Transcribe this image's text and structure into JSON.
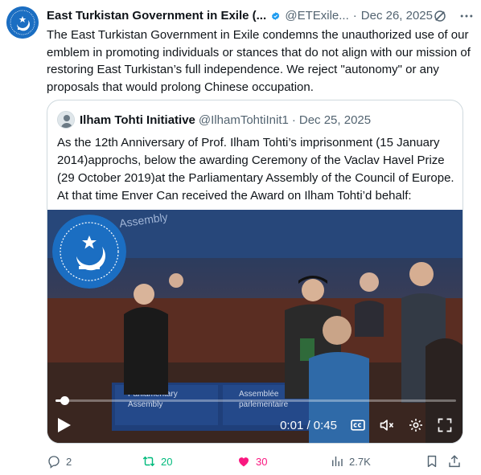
{
  "tweet": {
    "author_name": "East Turkistan Government in Exile (...",
    "author_handle": "@ETExile...",
    "separator": "·",
    "date": "Dec 26, 2025",
    "text": "The East Turkistan Government in Exile condemns the unauthorized use of our emblem in promoting individuals or stances that do not align with our mission of restoring East Turkistan’s full independence. We reject \"autonomy\" or any proposals that would prolong Chinese occupation.",
    "icons": {
      "avatar": "emblem-avatar",
      "verified": "verified-badge-icon",
      "grok": "grok-icon",
      "more": "more-icon"
    }
  },
  "quote": {
    "author_name": "Ilham Tohti Initiative",
    "author_handle": "@IlhamTohtiInit1",
    "separator": "·",
    "date": "Dec 25, 2025",
    "text": "As the 12th Anniversary of Prof. Ilham Tohti’s imprisonment (15 January 2014)approchs, below the awarding Ceremony of the Vaclav Havel Prize (29 October 2019)at the Parliamentary Assembly of the Council of Europe. At that time Enver Can received the Award on Ilham Tohti’d behalf:",
    "video": {
      "time": "0:01 / 0:45",
      "progress": 0.022,
      "icons": [
        "play-icon",
        "captions-icon",
        "mute-icon",
        "settings-icon",
        "fullscreen-icon"
      ]
    }
  },
  "actions": {
    "replies": "2",
    "retweets": "20",
    "likes": "30",
    "views": "2.7K"
  },
  "colors": {
    "retweet": "#00ba7c",
    "like": "#f91880",
    "muted": "#536471",
    "verified": "#1d9bf0"
  }
}
